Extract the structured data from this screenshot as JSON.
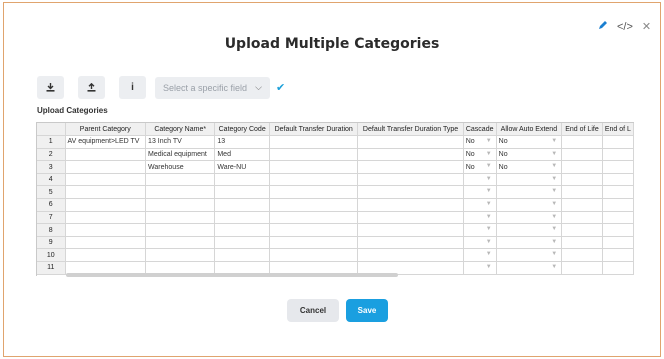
{
  "dialog": {
    "title": "Upload Multiple Categories",
    "top_icons": {
      "edit": "✎",
      "code": "</>",
      "close": "✕"
    }
  },
  "toolbar": {
    "field_select_placeholder": "Select a specific field",
    "info_label": "i"
  },
  "section_label": "Upload Categories",
  "table": {
    "headers": [
      "",
      "Parent Category",
      "Category Name*",
      "Category Code",
      "Default Transfer Duration",
      "Default Transfer Duration Type",
      "Cascade",
      "Allow Auto Extend",
      "End of Life",
      "End of L"
    ],
    "rows": [
      {
        "num": "1",
        "parent": "AV equipment>LED TV",
        "name": "13 Inch TV",
        "code": "13",
        "dur": "",
        "durtype": "",
        "cascade": "No",
        "auto": "No",
        "eol": "",
        "eol2": ""
      },
      {
        "num": "2",
        "parent": "",
        "name": "Medical equipment",
        "code": "Med",
        "dur": "",
        "durtype": "",
        "cascade": "No",
        "auto": "No",
        "eol": "",
        "eol2": ""
      },
      {
        "num": "3",
        "parent": "",
        "name": "Warehouse",
        "code": "Ware-NU",
        "dur": "",
        "durtype": "",
        "cascade": "No",
        "auto": "No",
        "eol": "",
        "eol2": ""
      },
      {
        "num": "4",
        "parent": "",
        "name": "",
        "code": "",
        "dur": "",
        "durtype": "",
        "cascade": "",
        "auto": "",
        "eol": "",
        "eol2": ""
      },
      {
        "num": "5",
        "parent": "",
        "name": "",
        "code": "",
        "dur": "",
        "durtype": "",
        "cascade": "",
        "auto": "",
        "eol": "",
        "eol2": ""
      },
      {
        "num": "6",
        "parent": "",
        "name": "",
        "code": "",
        "dur": "",
        "durtype": "",
        "cascade": "",
        "auto": "",
        "eol": "",
        "eol2": ""
      },
      {
        "num": "7",
        "parent": "",
        "name": "",
        "code": "",
        "dur": "",
        "durtype": "",
        "cascade": "",
        "auto": "",
        "eol": "",
        "eol2": ""
      },
      {
        "num": "8",
        "parent": "",
        "name": "",
        "code": "",
        "dur": "",
        "durtype": "",
        "cascade": "",
        "auto": "",
        "eol": "",
        "eol2": ""
      },
      {
        "num": "9",
        "parent": "",
        "name": "",
        "code": "",
        "dur": "",
        "durtype": "",
        "cascade": "",
        "auto": "",
        "eol": "",
        "eol2": ""
      },
      {
        "num": "10",
        "parent": "",
        "name": "",
        "code": "",
        "dur": "",
        "durtype": "",
        "cascade": "",
        "auto": "",
        "eol": "",
        "eol2": ""
      },
      {
        "num": "11",
        "parent": "",
        "name": "",
        "code": "",
        "dur": "",
        "durtype": "",
        "cascade": "",
        "auto": "",
        "eol": "",
        "eol2": ""
      }
    ]
  },
  "footer": {
    "cancel_label": "Cancel",
    "save_label": "Save"
  },
  "colors": {
    "accent": "#1a9fe0",
    "frame": "#e0a46e"
  }
}
